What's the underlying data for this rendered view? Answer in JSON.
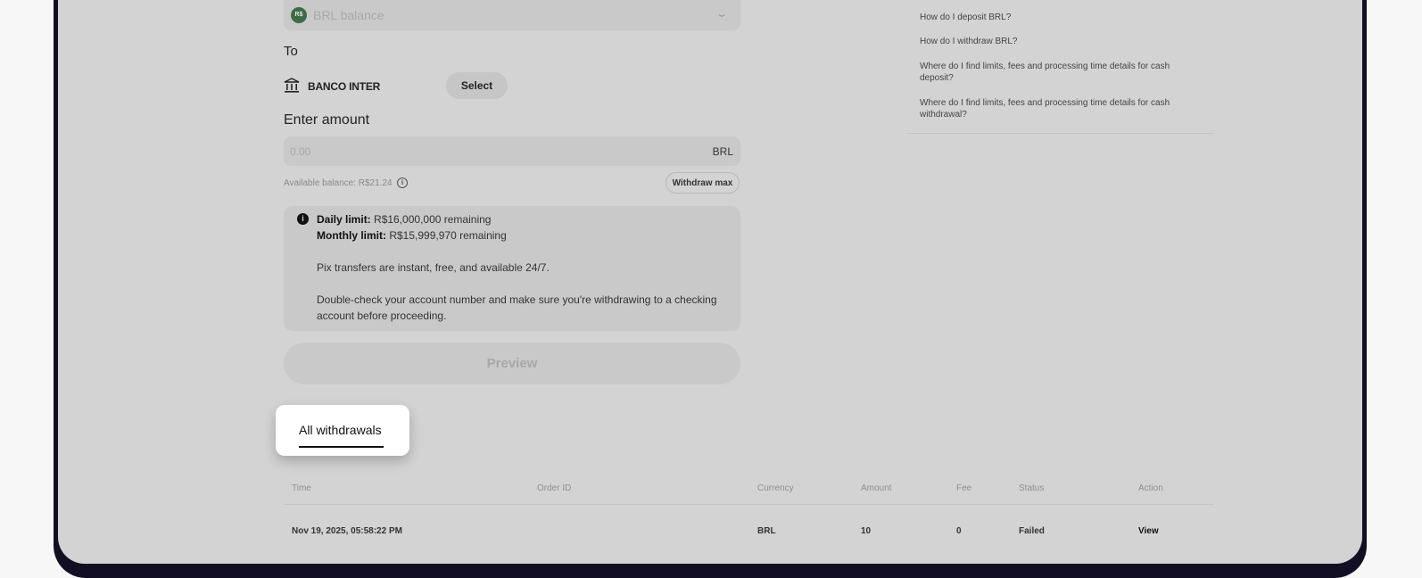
{
  "from": {
    "coin_label": "R$",
    "balance_placeholder": "BRL balance"
  },
  "to": {
    "label": "To",
    "bank_name": "BANCO INTER",
    "select_label": "Select"
  },
  "amount": {
    "label": "Enter amount",
    "placeholder": "0.00",
    "unit": "BRL",
    "available_balance": "Available balance: R$21.24",
    "withdraw_max_label": "Withdraw max"
  },
  "notice": {
    "daily_label": "Daily limit:",
    "daily_value": "R$16,000,000 remaining",
    "monthly_label": "Monthly limit:",
    "monthly_value": "R$15,999,970 remaining",
    "pix_text": "Pix transfers are instant, free, and available 24/7.",
    "check_line1": "Double-check your account number and make sure you're withdrawing to a checking",
    "check_line2": "account before proceeding."
  },
  "preview_label": "Preview",
  "faq": [
    "How do I deposit BRL?",
    "How do I withdraw BRL?",
    "Where do I find limits, fees and processing time details for cash deposit?",
    "Where do I find limits, fees and processing time details for cash withdrawal?"
  ],
  "tabs": {
    "all_withdrawals": "All withdrawals"
  },
  "table": {
    "headers": [
      "Time",
      "Order ID",
      "Currency",
      "Amount",
      "Fee",
      "Status",
      "Action"
    ],
    "rows": [
      [
        "Nov 19, 2025, 05:58:22 PM",
        "",
        "BRL",
        "10",
        "0",
        "Failed",
        "View"
      ]
    ]
  }
}
